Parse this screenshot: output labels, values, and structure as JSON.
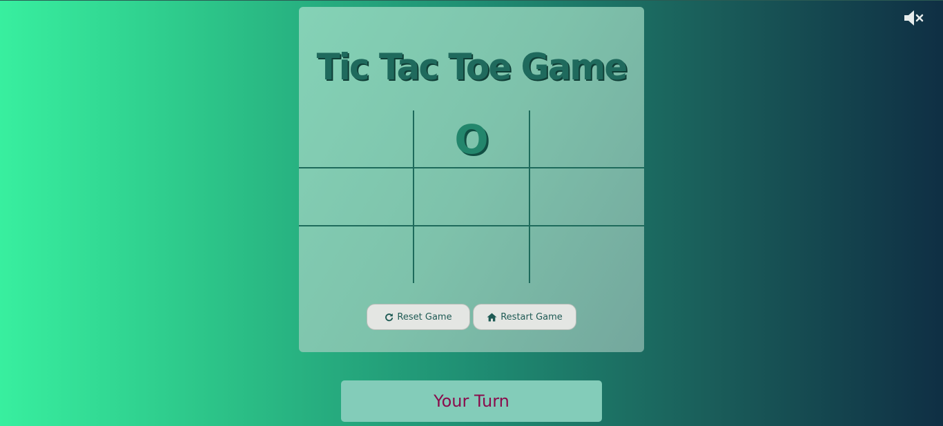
{
  "sound": {
    "icon": "volume-mute-icon",
    "state": "muted"
  },
  "game": {
    "title": "Tic Tac Toe Game",
    "board": [
      "",
      "O",
      "",
      "",
      "",
      "",
      "",
      "",
      ""
    ]
  },
  "buttons": {
    "reset": {
      "label": "Reset Game",
      "icon": "redo-icon"
    },
    "restart": {
      "label": "Restart Game",
      "icon": "home-icon"
    }
  },
  "status": {
    "text": "Your Turn"
  },
  "colors": {
    "accent": "#1f6a5d",
    "mark": "#23866c",
    "status_text": "#8a0c4c"
  }
}
